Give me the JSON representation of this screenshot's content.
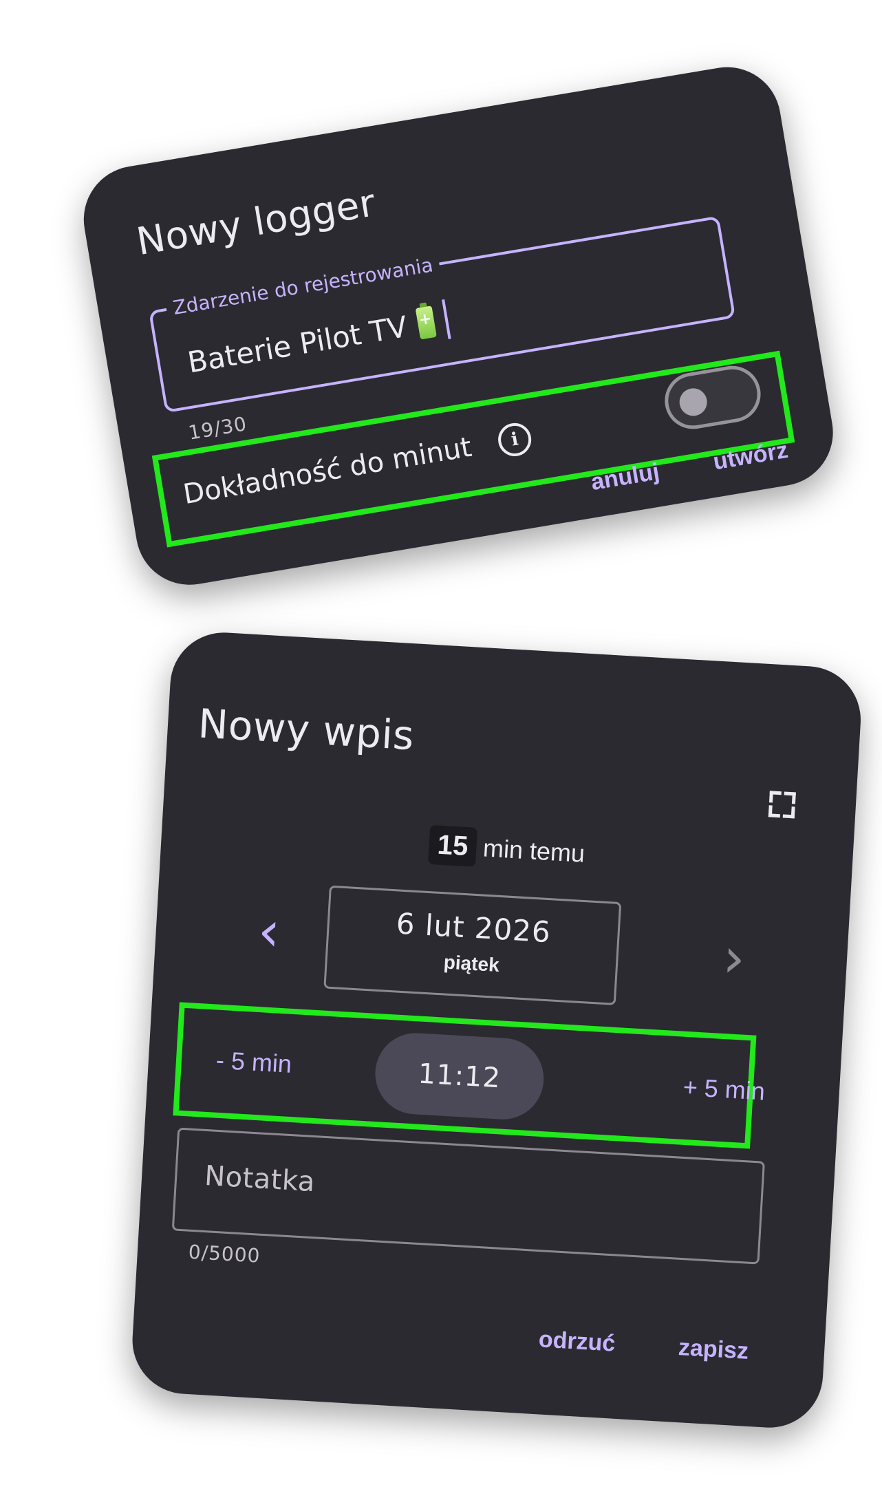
{
  "logger_dialog": {
    "title": "Nowy logger",
    "event_field": {
      "label": "Zdarzenie do rejestrowania",
      "value": "Baterie Pilot TV",
      "emoji_icon": "battery-icon",
      "counter": "19/30"
    },
    "precision": {
      "label": "Dokładność do minut",
      "info_icon": "info-icon",
      "toggle_on": false
    },
    "actions": {
      "cancel": "anuluj",
      "create": "utwórz"
    }
  },
  "entry_dialog": {
    "title": "Nowy wpis",
    "fullscreen_icon": "fullscreen-icon",
    "ago": {
      "value": "15",
      "unit": "min temu"
    },
    "date": {
      "main": "6 lut 2026",
      "weekday": "piątek",
      "prev_icon": "chevron-left-icon",
      "next_icon": "chevron-right-icon"
    },
    "time": {
      "minus": "- 5 min",
      "value": "11:12",
      "plus": "+ 5 min"
    },
    "note": {
      "placeholder": "Notatka",
      "counter": "0/5000"
    },
    "actions": {
      "discard": "odrzuć",
      "save": "zapisz"
    }
  },
  "colors": {
    "card_bg": "#2b2a30",
    "accent": "#c6b3ff",
    "highlight": "#22e81c",
    "time_pill": "#4b4857"
  }
}
